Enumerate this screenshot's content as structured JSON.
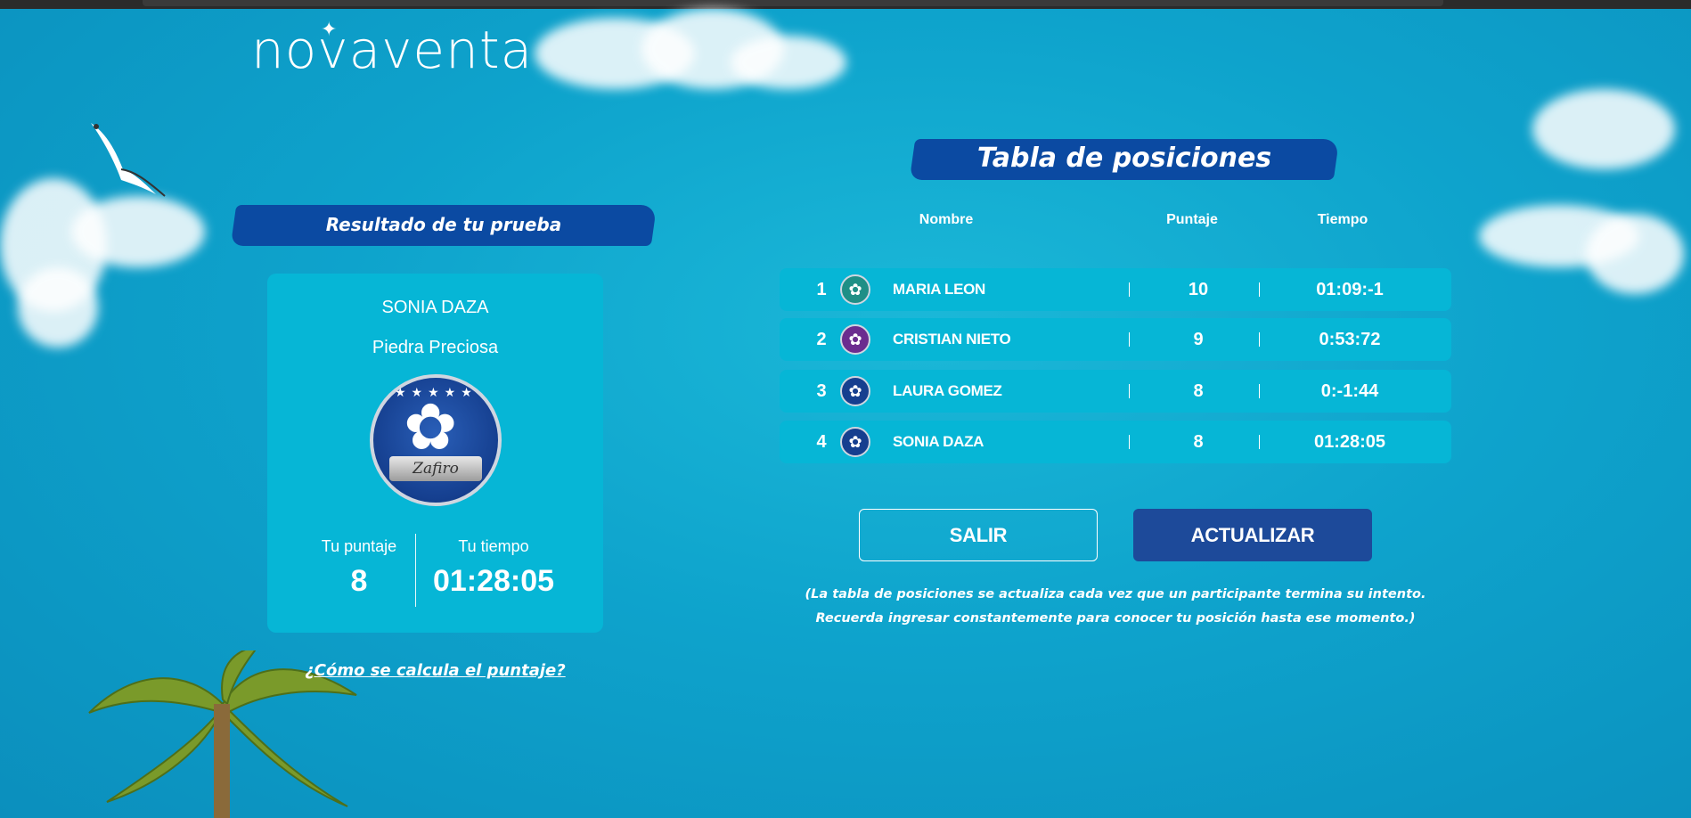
{
  "brand": {
    "logo_text": "novaventa"
  },
  "result": {
    "header": "Resultado de tu prueba",
    "name": "SONIA DAZA",
    "level": "Piedra Preciosa",
    "badge_text": "Zafiro",
    "score_label": "Tu puntaje",
    "score_value": "8",
    "time_label": "Tu tiempo",
    "time_value": "01:28:05",
    "how_link": "¿Cómo se calcula el puntaje?"
  },
  "leaderboard": {
    "title": "Tabla de posiciones",
    "columns": {
      "name": "Nombre",
      "points": "Puntaje",
      "time": "Tiempo"
    },
    "rows": [
      {
        "rank": "1",
        "name": "MARIA LEON",
        "points": "10",
        "time": "01:09:-1",
        "avatar_color": "#1f8f86"
      },
      {
        "rank": "2",
        "name": "CRISTIAN NIETO",
        "points": "9",
        "time": "0:53:72",
        "avatar_color": "#6b2c8f"
      },
      {
        "rank": "3",
        "name": "LAURA GOMEZ",
        "points": "8",
        "time": "0:-1:44",
        "avatar_color": "#163f8f"
      },
      {
        "rank": "4",
        "name": "SONIA DAZA",
        "points": "8",
        "time": "01:28:05",
        "avatar_color": "#163f8f"
      }
    ]
  },
  "buttons": {
    "exit": "SALIR",
    "refresh": "ACTUALIZAR"
  },
  "note": {
    "line1": "(La tabla de posiciones se actualiza cada vez que un participante termina su intento.",
    "line2": "Recuerda ingresar constantemente para conocer tu posición hasta ese momento.)"
  },
  "colors": {
    "background": "#0ea3cc",
    "card": "#06b6d6",
    "brush": "#0b4aa2",
    "primary_button": "#1d4a9a"
  }
}
